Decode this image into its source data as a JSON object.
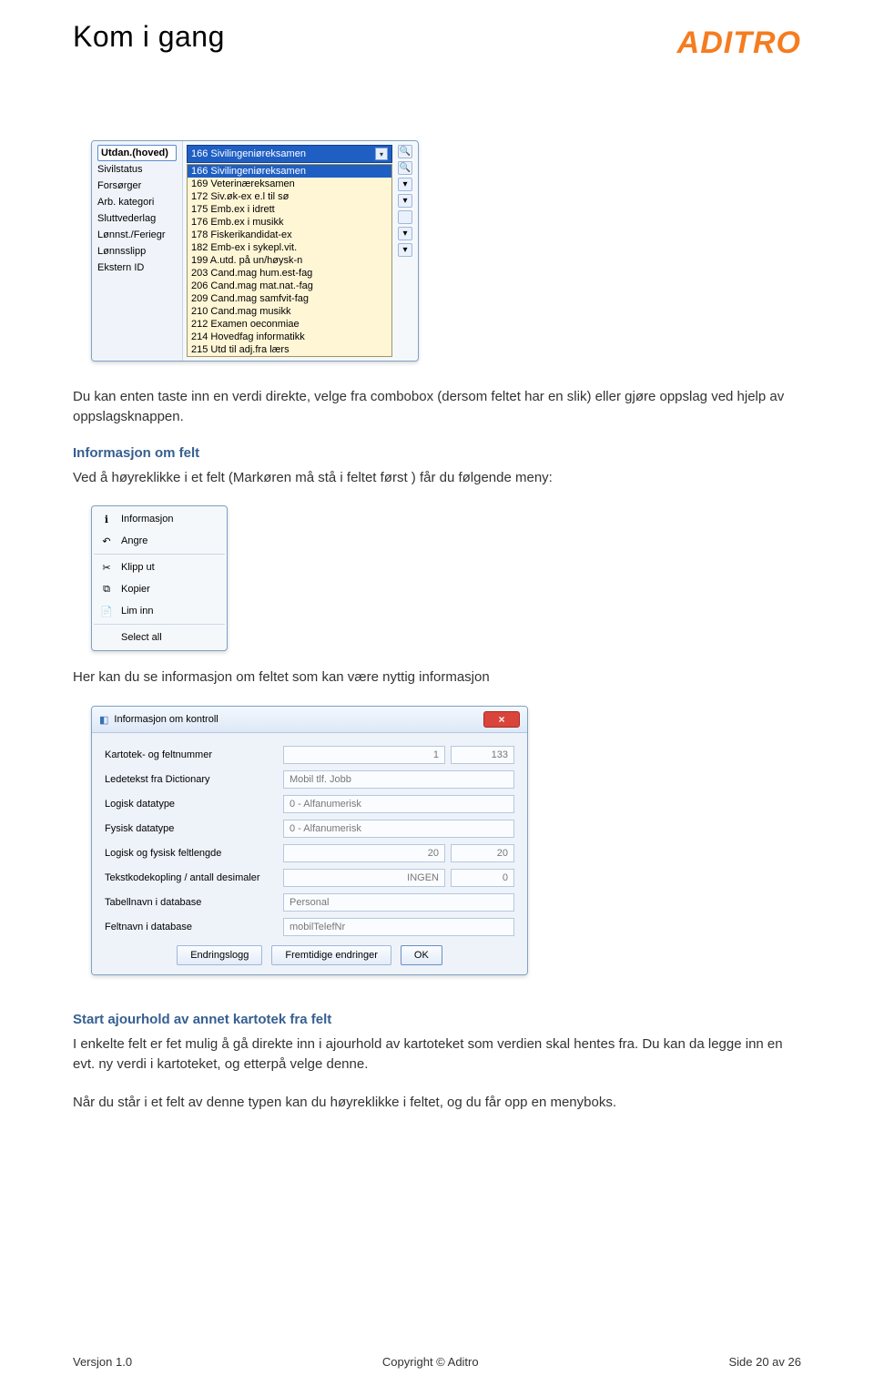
{
  "header": {
    "title": "Kom i gang",
    "brand": "ADITRO"
  },
  "combo": {
    "labels": [
      "Utdan.(hoved)",
      "Sivilstatus",
      "Forsørger",
      "Arb. kategori",
      "Sluttvederlag",
      "Lønnst./Feriegr",
      "Lønnsslipp",
      "Ekstern ID"
    ],
    "selected_label_index": 0,
    "selected_value": "166 Sivilingeniøreksamen",
    "options": [
      "166 Sivilingeniøreksamen",
      "169 Veterinæreksamen",
      "172 Siv.øk-ex e.l til sø",
      "175 Emb.ex i idrett",
      "176 Emb.ex i musikk",
      "178 Fiskerikandidat-ex",
      "182 Emb-ex i sykepl.vit.",
      "199 A.utd. på un/høysk-n",
      "203 Cand.mag hum.est-fag",
      "206 Cand.mag mat.nat.-fag",
      "209 Cand.mag samfvit-fag",
      "210 Cand.mag musikk",
      "212 Examen oeconmiae",
      "214 Hovedfag informatikk",
      "215 Utd til adj.fra lærs"
    ]
  },
  "para1": "Du kan enten taste inn en verdi direkte, velge fra combobox (dersom feltet har en slik) eller gjøre oppslag ved hjelp av oppslagsknappen.",
  "section1_heading": "Informasjon om felt",
  "section1_text": "Ved å høyreklikke i et felt (Markøren må stå i feltet først ) får du følgende meny:",
  "ctxmenu": {
    "items": [
      {
        "icon": "ℹ",
        "label": "Informasjon"
      },
      {
        "icon": "↶",
        "label": "Angre"
      },
      {
        "icon": "✂",
        "label": "Klipp ut",
        "sep_before": true
      },
      {
        "icon": "⧉",
        "label": "Kopier"
      },
      {
        "icon": "📄",
        "label": "Lim inn"
      },
      {
        "icon": "",
        "label": "Select all",
        "sep_before": true
      }
    ]
  },
  "para2": "Her kan du se informasjon om feltet som kan være nyttig informasjon",
  "dialog": {
    "title": "Informasjon om kontroll",
    "close": "×",
    "rows": [
      {
        "label": "Kartotek- og feltnummer",
        "v1": "1",
        "v2": "133"
      },
      {
        "label": "Ledetekst fra Dictionary",
        "v1": "Mobil tlf. Jobb"
      },
      {
        "label": "Logisk datatype",
        "v1": "0 - Alfanumerisk"
      },
      {
        "label": "Fysisk datatype",
        "v1": "0 - Alfanumerisk"
      },
      {
        "label": "Logisk og fysisk feltlengde",
        "v1": "20",
        "v2": "20"
      },
      {
        "label": "Tekstkodekopling / antall desimaler",
        "v1": "INGEN",
        "v2": "0"
      },
      {
        "label": "Tabellnavn i database",
        "v1": "Personal"
      },
      {
        "label": "Feltnavn i database",
        "v1": "mobilTelefNr"
      }
    ],
    "buttons": [
      "Endringslogg",
      "Fremtidige endringer",
      "OK"
    ]
  },
  "section2_heading": "Start ajourhold av annet kartotek fra felt",
  "section2_text1": "I enkelte felt er fet mulig å gå direkte inn i ajourhold av kartoteket som verdien skal hentes fra. Du kan da legge inn en evt. ny verdi i kartoteket, og etterpå velge denne.",
  "section2_text2": "Når du står i et felt av denne typen kan du høyreklikke i feltet, og du får opp en menyboks.",
  "footer": {
    "left": "Versjon 1.0",
    "center": "Copyright © Aditro",
    "right": "Side 20 av 26"
  }
}
